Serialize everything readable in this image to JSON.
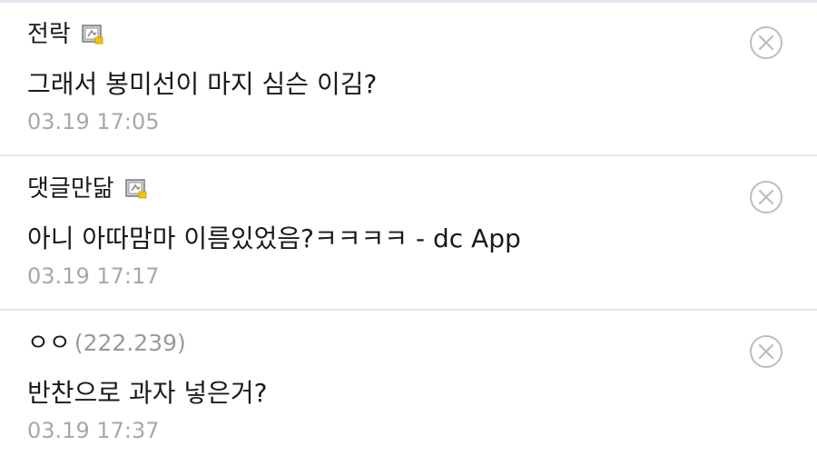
{
  "comments": [
    {
      "author": "전락",
      "ip": "",
      "has_badge": true,
      "text": "그래서 봉미선이 마지 심슨 이김?",
      "time": "03.19 17:05"
    },
    {
      "author": "댓글만닮",
      "ip": "",
      "has_badge": true,
      "text": "아니 아따맘마 이름있었음?ㅋㅋㅋㅋ - dc App",
      "time": "03.19 17:17"
    },
    {
      "author": "ㅇㅇ",
      "ip": "(222.239)",
      "has_badge": false,
      "text": "반찬으로 과자 넣은거?",
      "time": "03.19 17:37"
    }
  ],
  "icons": {
    "badge": "fixed-nick-badge-icon",
    "delete": "close-circle-icon"
  },
  "colors": {
    "text": "#1a1a1a",
    "meta": "#a8a8a8",
    "divider": "#e6e6ee",
    "badge_accent": "#f5c400"
  }
}
